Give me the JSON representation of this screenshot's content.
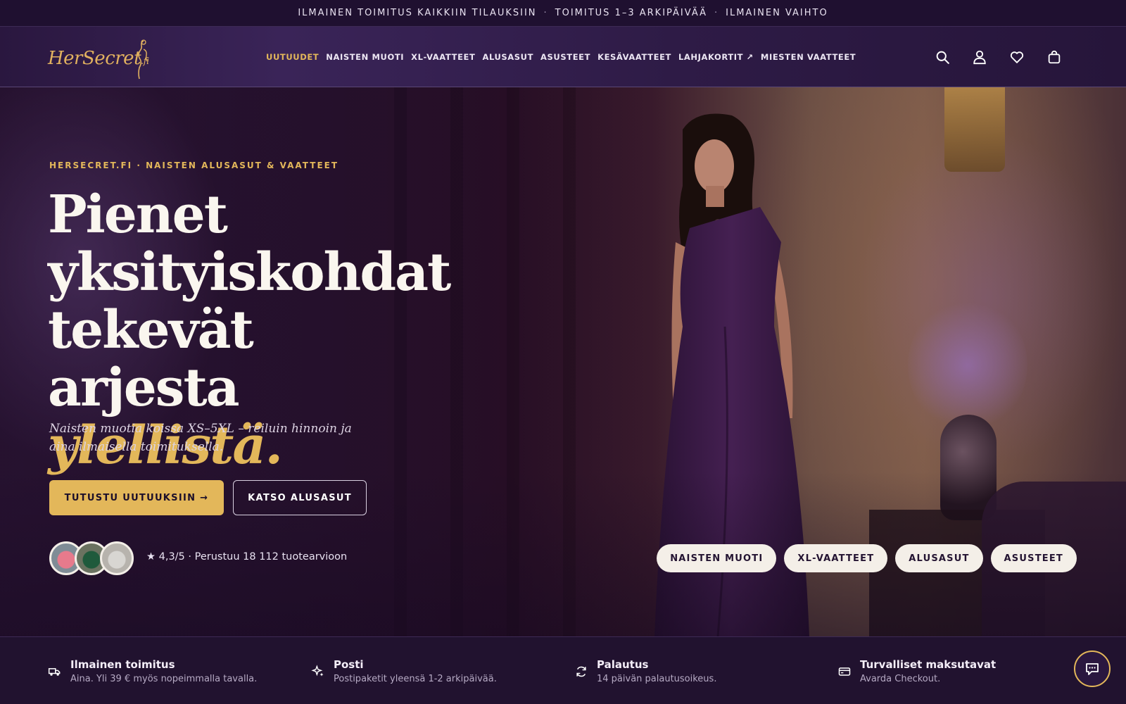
{
  "announcement": {
    "items": [
      "ILMAINEN TOIMITUS KAIKKIIN TILAUKSIIN",
      "TOIMITUS 1–3 ARKIPÄIVÄÄ",
      "ILMAINEN VAIHTO"
    ],
    "separator": "·"
  },
  "header": {
    "logo": {
      "text": "HerSecret",
      "domain": ".fi"
    },
    "nav": [
      {
        "label": "UUTUUDET",
        "active": true
      },
      {
        "label": "NAISTEN MUOTI"
      },
      {
        "label": "XL-VAATTEET"
      },
      {
        "label": "ALUSASUT"
      },
      {
        "label": "ASUSTEET"
      },
      {
        "label": "KESÄVAATTEET"
      },
      {
        "label": "LAHJAKORTIT ↗"
      },
      {
        "label": "MIESTEN VAATTEET"
      }
    ],
    "icons": [
      "search-icon",
      "account-icon",
      "wishlist-icon",
      "cart-icon"
    ]
  },
  "hero": {
    "kicker": "HERSECRET.FI · NAISTEN ALUSASUT & VAATTEET",
    "headline": "Pienet yksityiskohdat tekevät arjesta",
    "headline_accent": "ylellistä.",
    "subline": "Naisten muotia koissa XS–5XL – reiluin hinnoin ja aina ilmaisella toimituksella.",
    "primary_cta": "TUTUSTU UUTUUKSIIN →",
    "secondary_cta": "KATSO ALUSASUT",
    "rating_text": "★ 4,3/5 · Perustuu 18 112 tuotearvioon",
    "category_chips": [
      "NAISTEN MUOTI",
      "XL-VAATTEET",
      "ALUSASUT",
      "ASUSTEET"
    ]
  },
  "features": [
    {
      "icon": "truck-icon",
      "title": "Ilmainen toimitus",
      "sub": "Aina. Yli 39 € myös nopeimmalla tavalla."
    },
    {
      "icon": "sparkle-icon",
      "title": "Posti",
      "sub": "Postipaketit yleensä 1-2 arkipäivää."
    },
    {
      "icon": "refresh-icon",
      "title": "Palautus",
      "sub": "14 päivän palautusoikeus."
    },
    {
      "icon": "card-icon",
      "title": "Turvalliset maksutavat",
      "sub": "Avarda Checkout."
    }
  ],
  "colors": {
    "accent": "#e3b75a",
    "background": "#1c0f2a",
    "chip": "#f4efe8"
  }
}
